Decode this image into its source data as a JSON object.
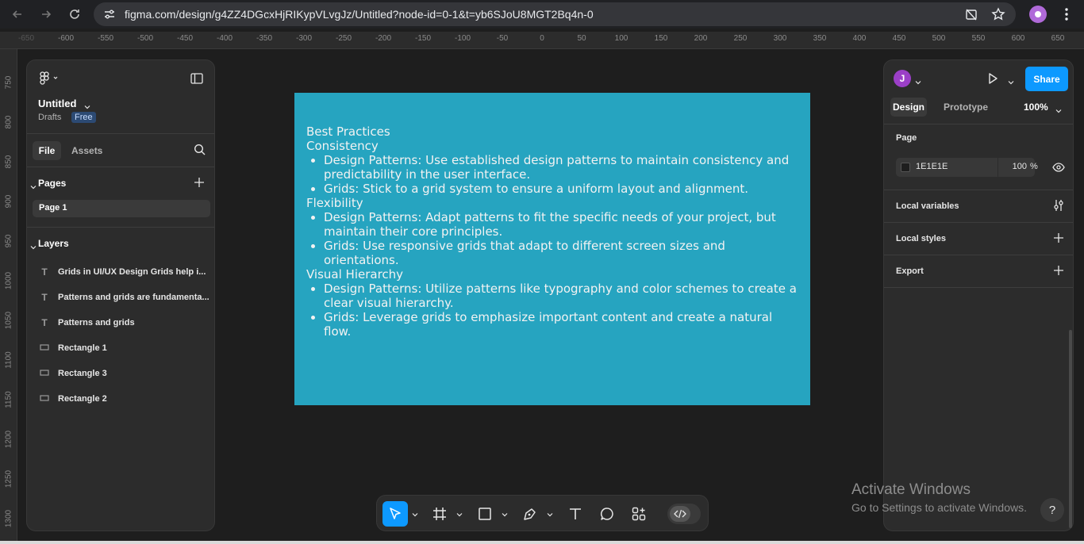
{
  "browser": {
    "url": "figma.com/design/g4ZZ4DGcxHjRIKypVLvgJz/Untitled?node-id=0-1&t=yb6SJoU8MGT2Bq4n-0"
  },
  "ruler": {
    "top_ticks": [
      "-650",
      "-600",
      "-550",
      "-500",
      "-450",
      "-400",
      "-350",
      "-300",
      "-250",
      "-200",
      "-150",
      "-100",
      "-50",
      "0",
      "50",
      "100",
      "150",
      "200",
      "250",
      "300",
      "350",
      "400",
      "450",
      "500",
      "550",
      "600",
      "650"
    ],
    "left_ticks": [
      "750",
      "800",
      "850",
      "900",
      "950",
      "1000",
      "1050",
      "1100",
      "1150",
      "1200",
      "1250",
      "1300"
    ]
  },
  "file": {
    "title": "Untitled",
    "location": "Drafts",
    "plan_badge": "Free"
  },
  "left_tabs": {
    "file": "File",
    "assets": "Assets"
  },
  "pages": {
    "label": "Pages",
    "items": [
      "Page 1"
    ]
  },
  "layers": {
    "label": "Layers",
    "items": [
      {
        "type": "text",
        "name": "Grids in UI/UX Design Grids help i..."
      },
      {
        "type": "text",
        "name": "Patterns and grids are fundamenta..."
      },
      {
        "type": "text",
        "name": "Patterns and grids"
      },
      {
        "type": "rectangle",
        "name": "Rectangle 1"
      },
      {
        "type": "rectangle",
        "name": "Rectangle 3"
      },
      {
        "type": "rectangle",
        "name": "Rectangle 2"
      }
    ]
  },
  "canvas": {
    "frame_color": "#26a4c0",
    "heading": "Best Practices",
    "sections": [
      {
        "title": "Consistency",
        "bullets": [
          "Design Patterns: Use established design patterns to maintain consistency and predictability in the user interface.",
          "Grids: Stick to a grid system to ensure a uniform layout and alignment."
        ]
      },
      {
        "title": "Flexibility",
        "bullets": [
          "Design Patterns: Adapt patterns to fit the specific needs of your project, but maintain their core principles.",
          "Grids: Use responsive grids that adapt to different screen sizes and orientations."
        ]
      },
      {
        "title": "Visual Hierarchy",
        "bullets": [
          "Design Patterns: Utilize patterns like typography and color schemes to create a clear visual hierarchy.",
          "Grids: Leverage grids to emphasize important content and create a natural flow."
        ]
      }
    ]
  },
  "right_panel": {
    "avatar_initial": "J",
    "share_label": "Share",
    "tab_design": "Design",
    "tab_prototype": "Prototype",
    "zoom": "100%",
    "page_label": "Page",
    "page_color": "1E1E1E",
    "page_opacity": "100",
    "percent_sign": "%",
    "local_variables": "Local variables",
    "local_styles": "Local styles",
    "export": "Export"
  },
  "toolbar": {
    "tools": [
      "move-tool",
      "frame-tool",
      "shape-tool",
      "pen-tool",
      "text-tool",
      "comment-tool",
      "actions-tool",
      "dev-mode-toggle"
    ]
  },
  "watermark": {
    "title": "Activate Windows",
    "subtitle": "Go to Settings to activate Windows."
  },
  "help": {
    "label": "?"
  },
  "colors": {
    "accent": "#0d99ff",
    "panel": "#2c2c2c",
    "canvas": "#1e1e1e",
    "avatar": "#9b3fc7"
  }
}
